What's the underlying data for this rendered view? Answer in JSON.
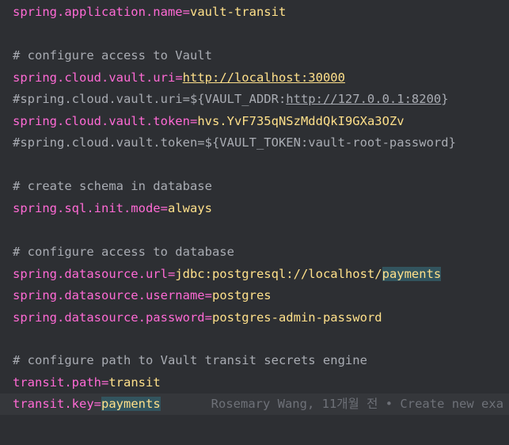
{
  "lines": {
    "l1": {
      "key": "spring.application.name",
      "eq": "=",
      "val": "vault-transit"
    },
    "l3": {
      "comment": "# configure access to Vault"
    },
    "l4": {
      "key": "spring.cloud.vault.uri",
      "eq": "=",
      "val": "http://localhost:30000"
    },
    "l5": {
      "prefix": "#spring.cloud.vault.uri=${VAULT_ADDR:",
      "url": "http://127.0.0.1:8200",
      "suffix": "}"
    },
    "l6": {
      "key": "spring.cloud.vault.token",
      "eq": "=",
      "val": "hvs.YvF735qNSzMddQkI9GXa3OZv"
    },
    "l7": {
      "text": "#spring.cloud.vault.token=${VAULT_TOKEN:vault-root-password}"
    },
    "l9": {
      "comment": "# create schema in database"
    },
    "l10": {
      "key": "spring.sql.init.mode",
      "eq": "=",
      "val": "always"
    },
    "l12": {
      "comment": "# configure access to database"
    },
    "l13": {
      "key": "spring.datasource.url",
      "eq": "=",
      "val": "jdbc:postgresql://localhost/",
      "val_hl": "payments"
    },
    "l14": {
      "key": "spring.datasource.username",
      "eq": "=",
      "val": "postgres"
    },
    "l15": {
      "key": "spring.datasource.password",
      "eq": "=",
      "val": "postgres-admin-password"
    },
    "l17": {
      "comment": "# configure path to Vault transit secrets engine"
    },
    "l18": {
      "key": "transit.path",
      "eq": "=",
      "val": "transit"
    },
    "l19": {
      "key": "transit.key",
      "eq": "=",
      "val_hl": "payments",
      "blame": "Rosemary Wang, 11개월 전 • Create new exa"
    }
  },
  "colors": {
    "background": "#2d2f33",
    "key": "#ff6ad5",
    "value": "#ffe08a",
    "comment": "#a9acb3",
    "highlight": "#32545e"
  }
}
